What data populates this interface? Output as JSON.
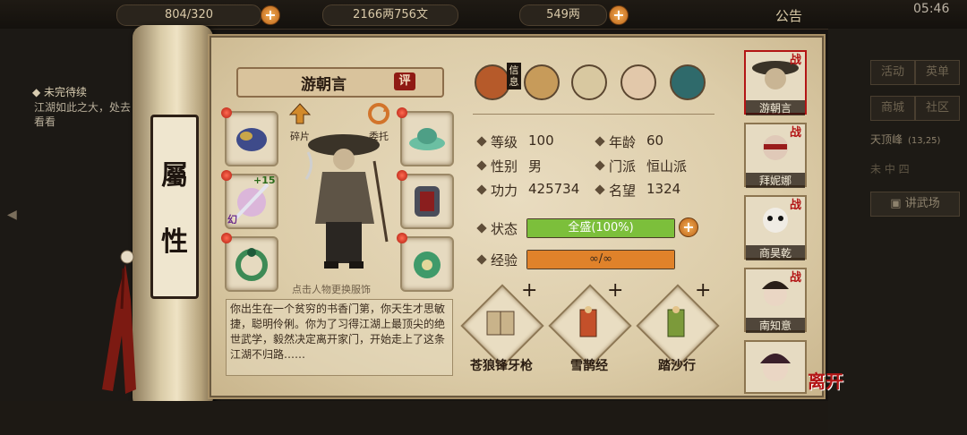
{
  "topbar": {
    "resource1": "804/320",
    "resource2": "2166两756文",
    "resource3": "549两",
    "notice": "公告",
    "clock": "05:46"
  },
  "quest": {
    "title": "未完待续",
    "text": "江湖如此之大，处去看看"
  },
  "scroll": {
    "label_1": "屬",
    "label_2": "性"
  },
  "character": {
    "name": "游朝言",
    "rate_label": "评",
    "fragment_label": "碎片",
    "delegate_label": "委托",
    "change_outfit_hint": "点击人物更换服饰",
    "weapon_level": "+15",
    "weapon_tag": "幻",
    "description": "你出生在一个贫穷的书香门第，你天生才思敏捷，聪明伶俐。你为了习得江湖上最顶尖的绝世武学，毅然决定离开家门，开始走上了这条江湖不归路……"
  },
  "info_tabs": {
    "info_label": "信息"
  },
  "stats": {
    "level_label": "等级",
    "level": "100",
    "age_label": "年龄",
    "age": "60",
    "gender_label": "性别",
    "gender": "男",
    "sect_label": "门派",
    "sect": "恒山派",
    "power_label": "功力",
    "power": "425734",
    "fame_label": "名望",
    "fame": "1324",
    "status_label": "状态",
    "status": "全盛(100%)",
    "status_fill": 1.0,
    "exp_label": "经验",
    "exp": "∞/∞",
    "exp_fill": 1.0
  },
  "skills": [
    {
      "name": "苍狼锋牙枪"
    },
    {
      "name": "雪鹊经"
    },
    {
      "name": "踏沙行"
    }
  ],
  "roster": [
    {
      "name": "游朝言",
      "tag": "战"
    },
    {
      "name": "拜妮娜",
      "tag": "战"
    },
    {
      "name": "商昊乾",
      "tag": "战"
    },
    {
      "name": "南知意",
      "tag": "战"
    },
    {
      "name": "",
      "tag": ""
    }
  ],
  "leave_label": "离开",
  "right_menu": {
    "b1": "活动",
    "b2": "英单",
    "b3": "商城",
    "b4": "社区",
    "location": "天顶峰",
    "location_coord": "(13,25)",
    "time": "未 中 四",
    "venue": "讲武场"
  },
  "colors": {
    "status_bar": "#7cbf3b",
    "exp_bar": "#e0822a",
    "accent_red": "#b31515"
  }
}
